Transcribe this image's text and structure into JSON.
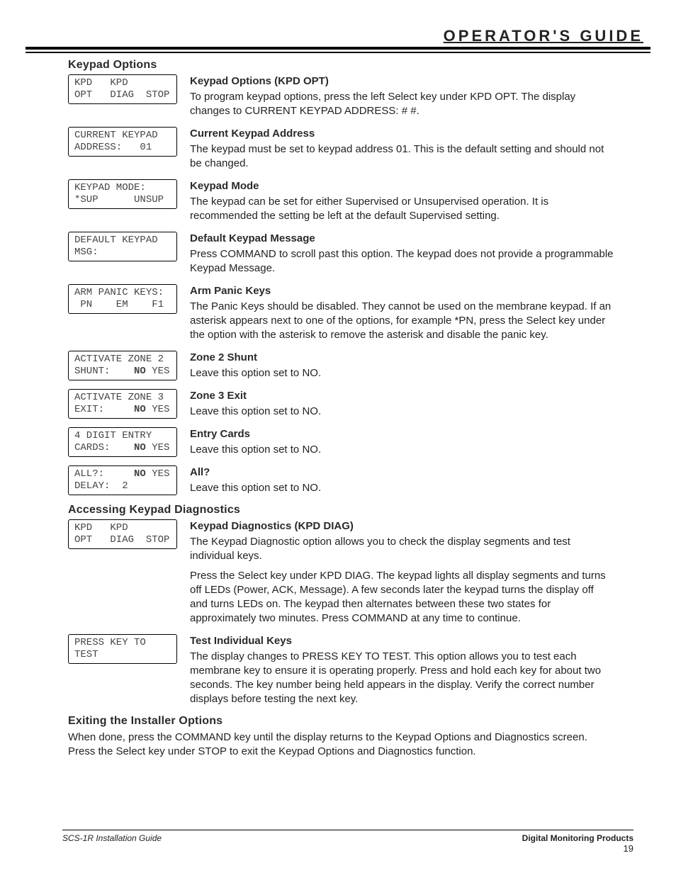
{
  "header": "OPERATOR'S GUIDE",
  "sections": {
    "s1": {
      "title": "Keypad Options",
      "items": [
        {
          "lcd": "KPD   KPD\nOPT   DIAG  STOP",
          "h": "Keypad Options (KPD OPT)",
          "p1": "To program keypad options, press the left Select key under KPD OPT.  The display changes to CURRENT KEYPAD ADDRESS:  # #."
        },
        {
          "lcd": "CURRENT KEYPAD\nADDRESS:   01",
          "h": "Current Keypad Address",
          "p1": "The keypad must be set to keypad address 01.  This is the default setting and should not be changed."
        },
        {
          "lcd": "KEYPAD MODE:\n*SUP      UNSUP",
          "h": "Keypad Mode",
          "p1": "The keypad can be set for either Supervised or Unsupervised operation.  It is recommended the setting be left at the default Supervised setting."
        },
        {
          "lcd": "DEFAULT KEYPAD\nMSG:",
          "h": "Default Keypad Message",
          "p1": "Press COMMAND to scroll past this option.  The keypad does not provide a programmable Keypad Message."
        },
        {
          "lcd": "ARM PANIC KEYS:\n PN    EM    F1",
          "h": "Arm Panic Keys",
          "p1": "The Panic Keys should be disabled.  They cannot be used on the membrane keypad.  If an asterisk appears next to one of the options, for example *PN, press the Select key under the option with the asterisk to remove the asterisk and disable the panic key."
        },
        {
          "lcd_html": "ACTIVATE ZONE 2\nSHUNT:    <b class='mono'>NO</b> YES",
          "h": "Zone 2 Shunt",
          "p1": "Leave this option set to NO."
        },
        {
          "lcd_html": "ACTIVATE ZONE 3\nEXIT:     <b class='mono'>NO</b> YES",
          "h": "Zone 3 Exit",
          "p1": "Leave this option set to NO."
        },
        {
          "lcd_html": "4 DIGIT ENTRY\nCARDS:    <b class='mono'>NO</b> YES",
          "h": "Entry Cards",
          "p1": "Leave this option set to NO."
        },
        {
          "lcd_html": "ALL?:     <b class='mono'>NO</b> YES\nDELAY:  2",
          "h": "All?",
          "p1": "Leave this option set to NO."
        }
      ]
    },
    "s2": {
      "title": "Accessing Keypad Diagnostics",
      "items": [
        {
          "lcd": "KPD   KPD\nOPT   DIAG  STOP",
          "h": "Keypad Diagnostics (KPD DIAG)",
          "p1": "The Keypad Diagnostic option allows you to check the display segments and test individual keys.",
          "p2": "Press the Select key under KPD DIAG.  The keypad lights all display segments and turns off LEDs (Power, ACK, Message).  A few seconds later the keypad turns the display off and turns LEDs on.  The keypad then alternates between these two states for approximately two minutes.  Press COMMAND at any time to continue."
        },
        {
          "lcd": "PRESS KEY TO\nTEST",
          "h": "Test Individual Keys",
          "p1": "The display changes to PRESS KEY TO TEST.  This option allows you to test each membrane key to ensure it is operating properly.  Press and hold each key for about two seconds.  The key number being held appears in the display.  Verify the correct number displays before testing the next key."
        }
      ]
    },
    "s3": {
      "title": "Exiting the Installer Options",
      "body": "When done, press the COMMAND key until the display returns to the Keypad Options and Diagnostics screen.  Press the Select key under STOP to exit the Keypad Options and Diagnostics function."
    }
  },
  "footer": {
    "left": "SCS-1R Installation Guide",
    "right_brand": "Digital Monitoring Products",
    "page": "19"
  }
}
